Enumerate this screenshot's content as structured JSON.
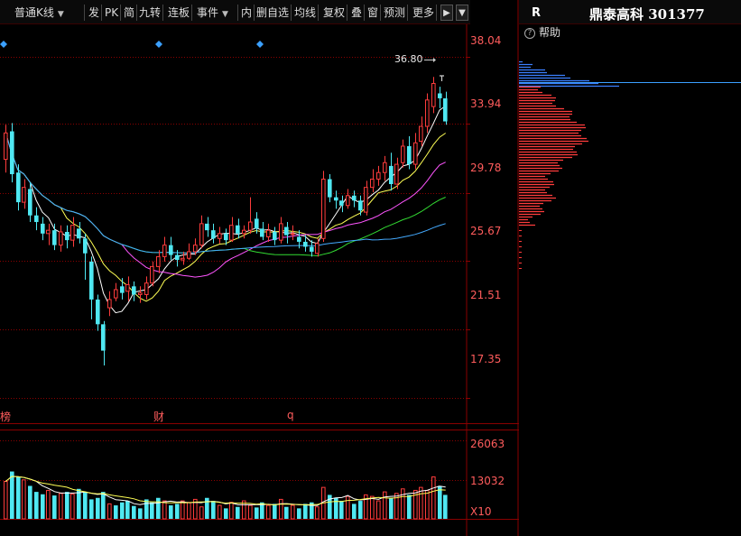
{
  "toolbar": {
    "kline_type": "普通K线",
    "items": [
      "发",
      "PK",
      "简",
      "九转",
      "连板",
      "事件",
      "内",
      "删自选",
      "均线",
      "复权",
      "叠",
      "窗",
      "预测",
      "更多"
    ]
  },
  "panel": {
    "r_label": "R",
    "stock_name": "鼎泰高科",
    "stock_code": "301377",
    "help_label": "帮助"
  },
  "price_axis": [
    "38.04",
    "33.94",
    "29.78",
    "25.67",
    "21.51",
    "17.35"
  ],
  "volume_axis": [
    "26063",
    "13032"
  ],
  "volume_unit": "X10",
  "markers": [
    "榜",
    "财",
    "q"
  ],
  "max_price_label": "36.80",
  "colors": {
    "up": "#ff3c3c",
    "down": "#4fe8f2",
    "grid": "#8a0000",
    "axis_text": "#ff5c5c"
  },
  "chart_data": {
    "type": "candlestick",
    "title": "",
    "ylim": [
      15.8,
      39.0
    ],
    "candles": [
      [
        31.8,
        33.4,
        33.9,
        31.0
      ],
      [
        33.5,
        30.9,
        34.0,
        30.4
      ],
      [
        31.0,
        29.2,
        31.5,
        28.7
      ],
      [
        29.2,
        30.1,
        30.6,
        28.8
      ],
      [
        30.0,
        28.4,
        30.4,
        28.0
      ],
      [
        28.4,
        28.0,
        28.9,
        27.5
      ],
      [
        27.9,
        27.3,
        28.3,
        26.9
      ],
      [
        27.3,
        27.5,
        27.9,
        26.6
      ],
      [
        27.5,
        26.6,
        27.9,
        26.3
      ],
      [
        26.6,
        27.4,
        27.8,
        26.2
      ],
      [
        27.4,
        26.9,
        27.8,
        26.4
      ],
      [
        26.9,
        27.8,
        28.3,
        26.5
      ],
      [
        27.6,
        27.0,
        28.0,
        26.7
      ],
      [
        27.0,
        26.1,
        27.3,
        24.5
      ],
      [
        25.6,
        23.3,
        25.9,
        22.1
      ],
      [
        23.3,
        21.8,
        23.6,
        21.4
      ],
      [
        21.8,
        20.2,
        22.0,
        19.3
      ],
      [
        22.8,
        23.3,
        23.8,
        22.3
      ],
      [
        23.4,
        23.9,
        24.3,
        23.2
      ],
      [
        24.1,
        23.7,
        24.6,
        23.3
      ],
      [
        23.8,
        24.2,
        24.7,
        23.2
      ],
      [
        24.1,
        23.6,
        24.4,
        23.2
      ],
      [
        23.6,
        23.7,
        24.1,
        23.1
      ],
      [
        23.6,
        24.3,
        24.7,
        23.3
      ],
      [
        24.3,
        25.3,
        25.6,
        24.1
      ],
      [
        25.3,
        25.9,
        26.3,
        24.9
      ],
      [
        25.9,
        26.6,
        27.1,
        25.6
      ],
      [
        26.6,
        26.0,
        27.1,
        25.7
      ],
      [
        26.0,
        25.7,
        26.3,
        25.3
      ],
      [
        25.7,
        25.8,
        26.2,
        25.4
      ],
      [
        25.8,
        26.2,
        26.7,
        25.7
      ],
      [
        26.2,
        26.6,
        27.0,
        26.0
      ],
      [
        26.6,
        27.9,
        28.4,
        26.4
      ],
      [
        27.9,
        27.5,
        28.3,
        27.1
      ],
      [
        27.5,
        27.0,
        27.9,
        26.7
      ],
      [
        27.0,
        27.3,
        27.7,
        26.7
      ],
      [
        27.3,
        26.9,
        27.6,
        26.6
      ],
      [
        26.9,
        27.8,
        28.3,
        26.8
      ],
      [
        27.8,
        27.3,
        28.2,
        27.0
      ],
      [
        27.3,
        27.5,
        27.8,
        27.0
      ],
      [
        27.5,
        28.0,
        29.5,
        27.3
      ],
      [
        28.2,
        27.6,
        28.6,
        27.3
      ],
      [
        27.6,
        27.1,
        28.0,
        26.9
      ],
      [
        27.1,
        27.5,
        27.9,
        26.8
      ],
      [
        27.4,
        26.9,
        27.7,
        26.6
      ],
      [
        26.9,
        27.9,
        28.3,
        26.7
      ],
      [
        27.7,
        27.2,
        28.0,
        26.7
      ],
      [
        27.3,
        27.3,
        27.8,
        26.9
      ],
      [
        27.1,
        26.8,
        27.5,
        26.4
      ],
      [
        26.8,
        26.5,
        27.2,
        26.2
      ],
      [
        26.5,
        26.2,
        26.9,
        25.9
      ],
      [
        26.1,
        26.7,
        27.0,
        25.9
      ],
      [
        27.0,
        30.6,
        31.1,
        26.8
      ],
      [
        30.6,
        29.5,
        30.9,
        29.2
      ],
      [
        29.5,
        29.3,
        29.9,
        28.8
      ],
      [
        29.3,
        29.0,
        29.6,
        28.6
      ],
      [
        29.0,
        29.6,
        30.0,
        28.8
      ],
      [
        29.6,
        29.3,
        29.9,
        28.9
      ],
      [
        29.3,
        28.7,
        29.6,
        28.4
      ],
      [
        28.6,
        30.1,
        30.5,
        28.4
      ],
      [
        30.1,
        30.6,
        31.2,
        29.8
      ],
      [
        30.6,
        31.0,
        31.4,
        30.2
      ],
      [
        31.0,
        31.6,
        32.0,
        30.5
      ],
      [
        31.4,
        30.3,
        32.2,
        29.9
      ],
      [
        30.3,
        31.5,
        31.9,
        30.0
      ],
      [
        31.6,
        32.6,
        33.0,
        31.3
      ],
      [
        32.6,
        31.5,
        33.2,
        31.2
      ],
      [
        31.5,
        32.8,
        33.4,
        31.2
      ],
      [
        32.9,
        33.8,
        34.4,
        32.6
      ],
      [
        33.8,
        35.4,
        35.8,
        33.4
      ],
      [
        35.0,
        36.4,
        36.8,
        34.6
      ],
      [
        35.8,
        35.5,
        36.2,
        34.9
      ],
      [
        35.5,
        34.1,
        35.9,
        33.9
      ]
    ],
    "volume_ylim": [
      0,
      28000
    ],
    "volumes": [
      12500,
      15800,
      14000,
      13000,
      11000,
      9000,
      8200,
      9500,
      7800,
      8500,
      9000,
      8300,
      10000,
      9000,
      6500,
      7000,
      9000,
      5000,
      4500,
      5500,
      6000,
      4300,
      3500,
      6500,
      5500,
      7000,
      6000,
      4500,
      5000,
      6000,
      5500,
      6500,
      4000,
      7000,
      6000,
      4500,
      3500,
      5500,
      4000,
      6000,
      4500,
      3800,
      5500,
      4500,
      5000,
      6500,
      4000,
      4500,
      3500,
      5000,
      5500,
      4000,
      10500,
      8000,
      7000,
      6000,
      7500,
      5000,
      6000,
      8000,
      7500,
      6000,
      9000,
      7000,
      8500,
      10000,
      8000,
      9500,
      10500,
      9500,
      14000,
      11000,
      8000
    ],
    "volume_down_override": [
      18,
      19,
      20,
      21,
      22,
      23,
      24,
      25
    ]
  }
}
